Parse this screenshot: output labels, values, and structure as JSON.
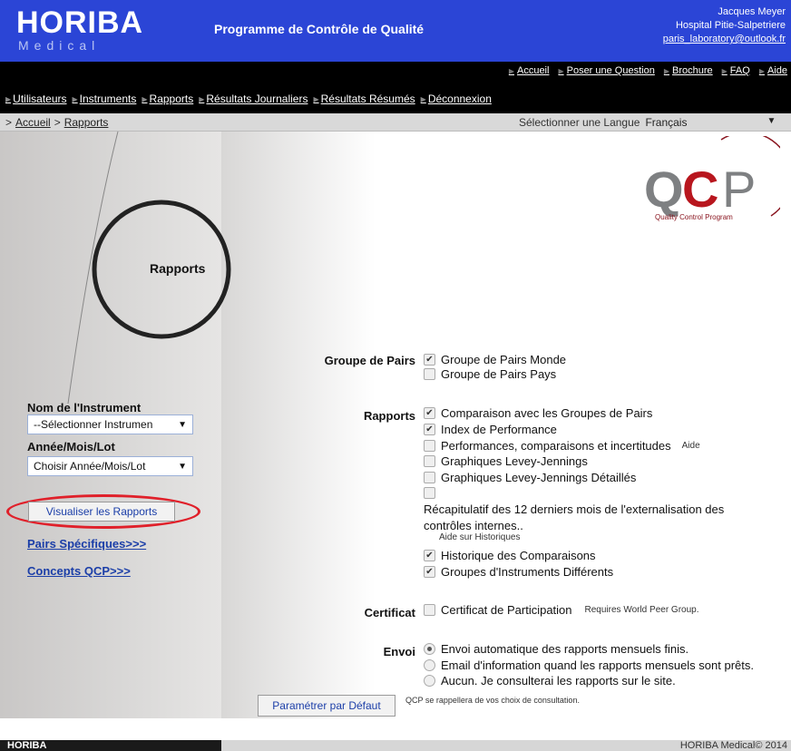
{
  "header": {
    "logo": "HORIBA",
    "logo_sub": "Medical",
    "program_title": "Programme de Contrôle de Qualité",
    "user_name": "Jacques Meyer",
    "hospital": "Hospital Pitie-Salpetriere",
    "email": "paris_laboratory@outlook.fr"
  },
  "topnav": [
    {
      "label": "Accueil"
    },
    {
      "label": "Poser une Question"
    },
    {
      "label": "Brochure"
    },
    {
      "label": "FAQ"
    },
    {
      "label": "Aide"
    }
  ],
  "mainnav": [
    {
      "label": "Utilisateurs"
    },
    {
      "label": "Instruments"
    },
    {
      "label": "Rapports"
    },
    {
      "label": "Résultats Journaliers"
    },
    {
      "label": "Résultats Résumés"
    },
    {
      "label": "Déconnexion"
    }
  ],
  "breadcrumb": {
    "sep": ">",
    "home": "Accueil",
    "current": "Rapports"
  },
  "language": {
    "label": "Sélectionner une Langue",
    "value": "Français"
  },
  "left": {
    "title": "Rapports",
    "instrument_label": "Nom de l'Instrument",
    "instrument_value": "--Sélectionner Instrumen",
    "period_label": "Année/Mois/Lot",
    "period_value": "Choisir Année/Mois/Lot",
    "view_button": "Visualiser les Rapports",
    "link_pairs": "Pairs Spécifiques>>>",
    "link_concepts": "Concepts QCP>>>"
  },
  "qcp_logo": {
    "text": "QCP",
    "caption": "Quality Control Program"
  },
  "form": {
    "peer_group": {
      "label": "Groupe de Pairs",
      "options": [
        {
          "label": "Groupe de Pairs Monde",
          "checked": true
        },
        {
          "label": "Groupe de Pairs Pays",
          "checked": false
        }
      ]
    },
    "reports": {
      "label": "Rapports",
      "options": [
        {
          "label": "Comparaison avec les Groupes de Pairs",
          "checked": true
        },
        {
          "label": "Index de Performance",
          "checked": true
        },
        {
          "label": "Performances, comparaisons et incertitudes",
          "checked": false,
          "help": "Aide"
        },
        {
          "label": "Graphiques Levey-Jennings",
          "checked": false
        },
        {
          "label": "Graphiques Levey-Jennings Détaillés",
          "checked": false
        }
      ],
      "recap_text": "Récapitulatif des 12 derniers mois de l'externalisation des contrôles internes..",
      "history_help": "Aide sur Historiques",
      "history_options": [
        {
          "label": "Historique des Comparaisons",
          "checked": true
        },
        {
          "label": "Groupes d'Instruments Différents",
          "checked": true
        }
      ]
    },
    "certificate": {
      "label": "Certificat",
      "option": "Certificat de Participation",
      "note": "Requires World Peer Group."
    },
    "delivery": {
      "label": "Envoi",
      "options": [
        {
          "label": "Envoi automatique des rapports mensuels finis.",
          "selected": true
        },
        {
          "label": "Email d'information quand les rapports mensuels sont prêts.",
          "selected": false
        },
        {
          "label": "Aucun. Je consulterai les rapports sur le site.",
          "selected": false
        }
      ]
    },
    "default_button": "Paramétrer par Défaut",
    "default_note": "QCP se rappellera de vos choix de consultation."
  },
  "footer": {
    "left": "HORIBA",
    "right": "HORIBA Medical© 2014"
  }
}
